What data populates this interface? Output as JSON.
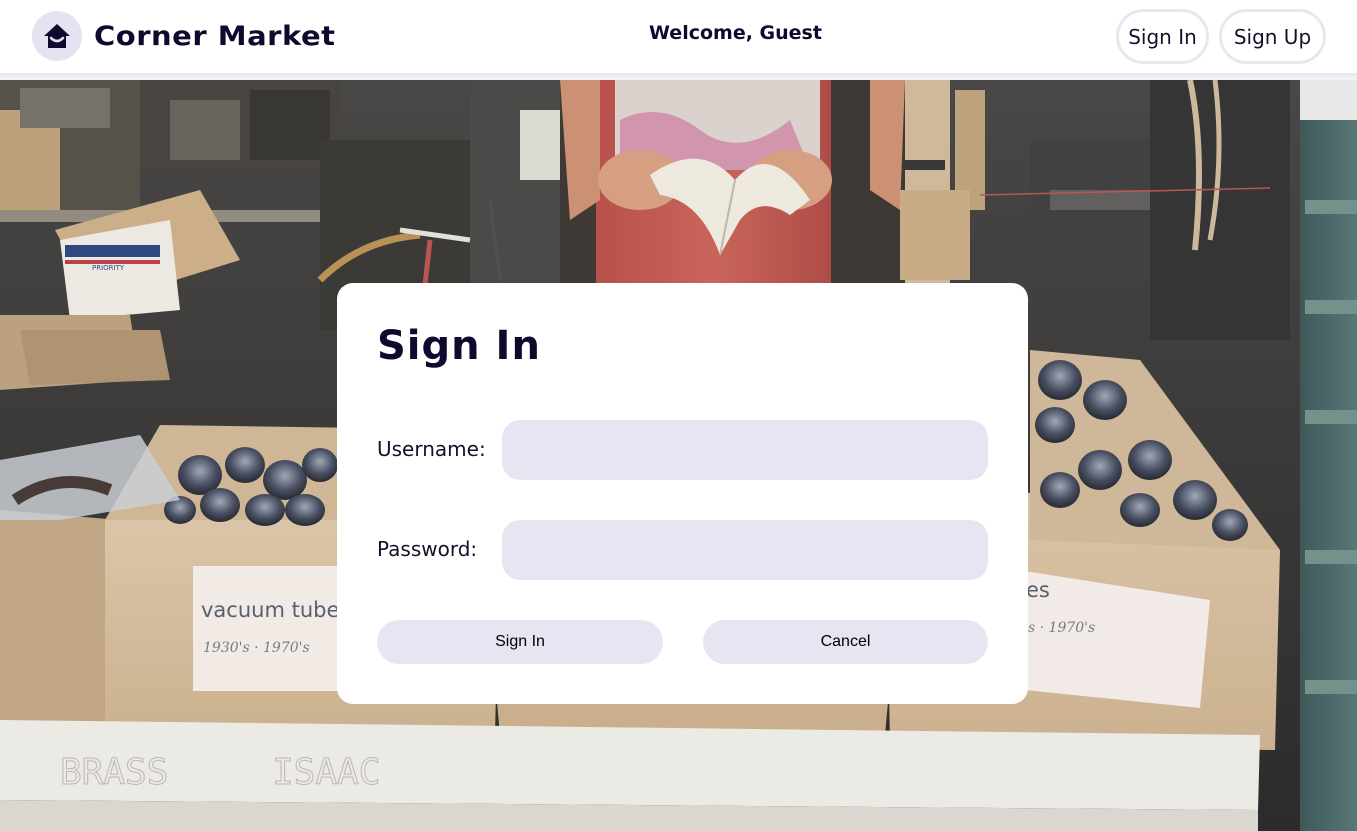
{
  "header": {
    "brand": "Corner Market",
    "welcome": "Welcome, Guest",
    "signin_label": "Sign In",
    "signup_label": "Sign Up",
    "logo_icon": "house-icon"
  },
  "background": {
    "box_label_left": "vacuum tube",
    "box_sublabel_left": "1930's · 1970's",
    "box_label_right": "es",
    "box_sublabel_right": "s · 1970's",
    "table_scrawl_1": "BRASS",
    "table_scrawl_2": "ISAAC",
    "shipping_box_text": "PRIORITY"
  },
  "dialog": {
    "title": "Sign In",
    "username_label": "Username:",
    "username_value": "",
    "password_label": "Password:",
    "password_value": "",
    "submit_label": "Sign In",
    "cancel_label": "Cancel"
  },
  "colors": {
    "brand_navy": "#0d0a2e",
    "input_fill": "#e6e5f2",
    "logo_circle": "#e5e3f1"
  }
}
